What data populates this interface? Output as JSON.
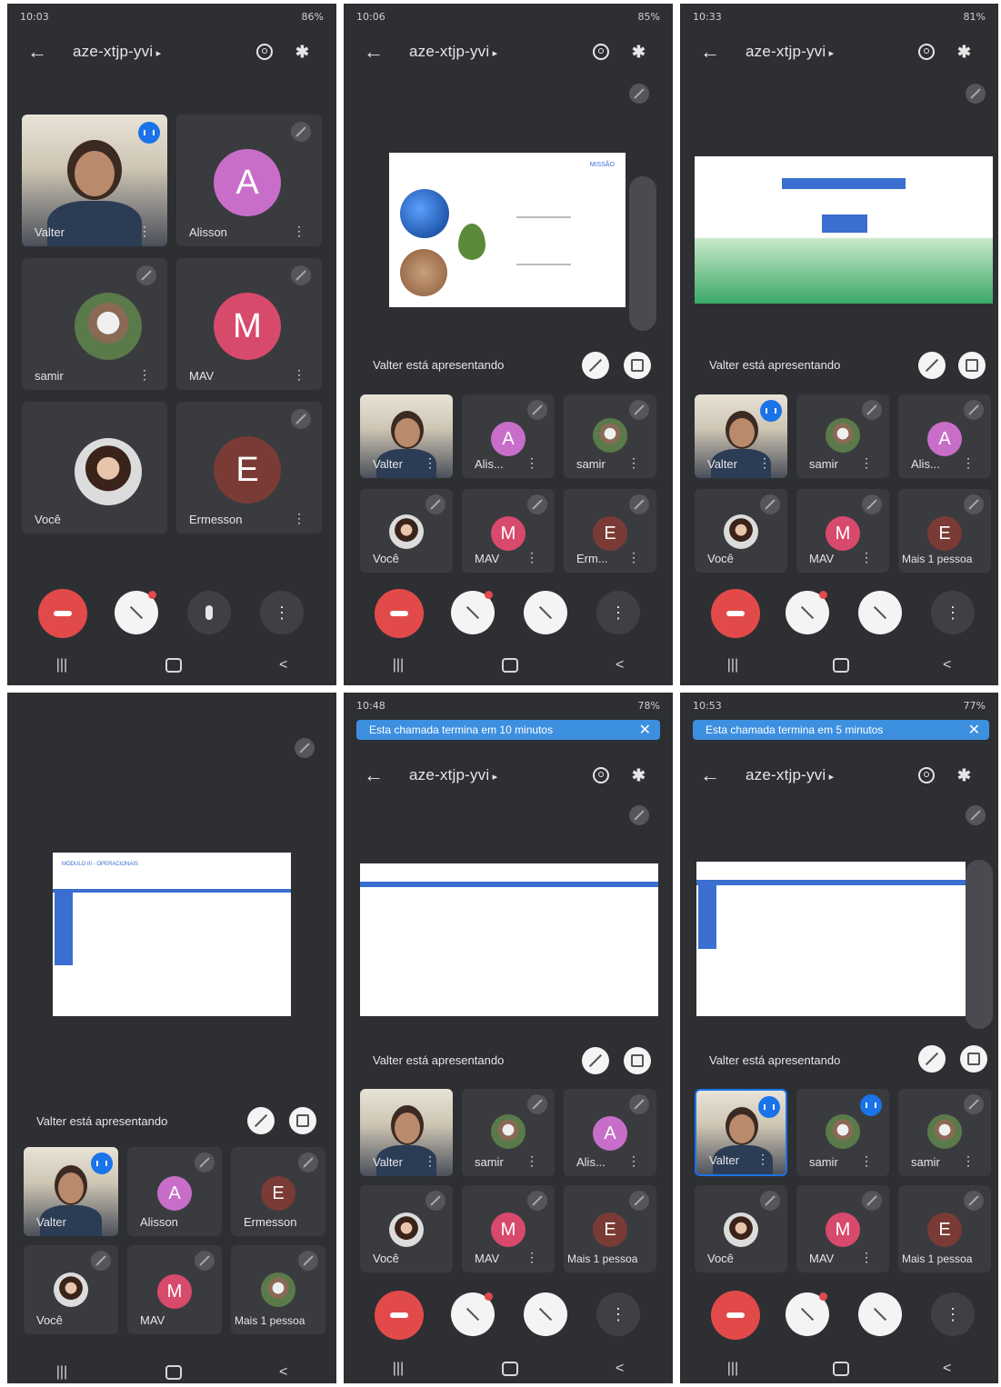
{
  "meeting_code": "aze-xtjp-yvi",
  "presenting_text": "Valter está apresentando",
  "status_times": [
    "10:03",
    "10:06",
    "10:33",
    "10:48",
    "10:53"
  ],
  "status_battery": [
    "86%",
    "85%",
    "81%",
    "78%",
    "77%"
  ],
  "banners": {
    "ten_min": "Esta chamada termina em 10 minutos",
    "five_min": "Esta chamada termina em 5 minutos"
  },
  "participants": {
    "valter": "Valter",
    "alisson": "Alisson",
    "alisson_short": "Alis...",
    "samir": "samir",
    "mav": "MAV",
    "voce": "Você",
    "ermesson": "Ermesson",
    "ermesson_short": "Erm...",
    "mais": "Mais 1 pessoa"
  },
  "avatar_letters": {
    "a": "A",
    "m": "M",
    "e": "E"
  },
  "colors": {
    "alisson": "#c86ec9",
    "mav": "#d84a6c",
    "ermesson": "#7a3b36",
    "hangup": "#e24a4a",
    "active_speaker": "#1a73e8",
    "banner": "#3d8fe0"
  },
  "icons": {
    "back": "←",
    "bluetooth": "✱",
    "more": "⋮",
    "close": "✕",
    "nav_recents": "|||",
    "nav_back": "<"
  },
  "slide1": {
    "label": "MISSÃO"
  },
  "slide3": {
    "header": "MÓDULO III - OPERACIONAIS"
  }
}
